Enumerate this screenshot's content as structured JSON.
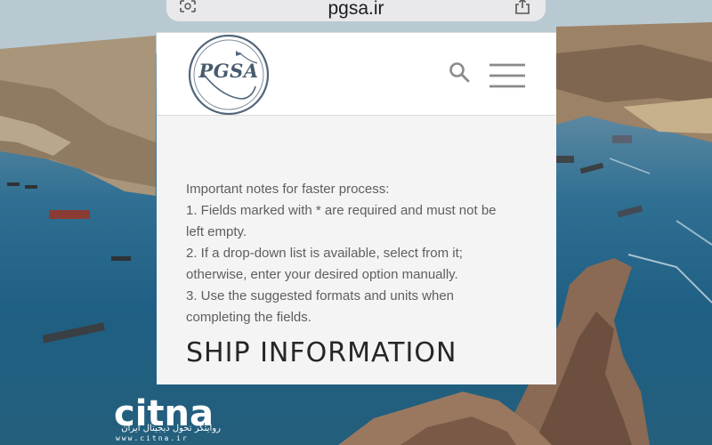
{
  "browser": {
    "url": "pgsa.ir"
  },
  "site": {
    "logo_text": "PGSA"
  },
  "notes": {
    "title": "Important notes for faster process:",
    "lines": [
      "1. Fields marked with * are required and must not be",
      "left empty.",
      "2. If a drop-down list is available, select from it;",
      "otherwise, enter your desired option manually.",
      "3. Use the suggested formats and units when",
      "completing the fields."
    ]
  },
  "section": {
    "heading": "SHIP INFORMATION"
  },
  "watermark": {
    "brand": "citna",
    "tagline": "روایتگر تحول دیجیتال ایران",
    "url": "www.citna.ir"
  },
  "colors": {
    "page_bg": "#f4f4f4",
    "header_bg": "#ffffff",
    "heading_text": "#262626",
    "body_text": "#5e5e5e",
    "logo": "#475a6d"
  }
}
